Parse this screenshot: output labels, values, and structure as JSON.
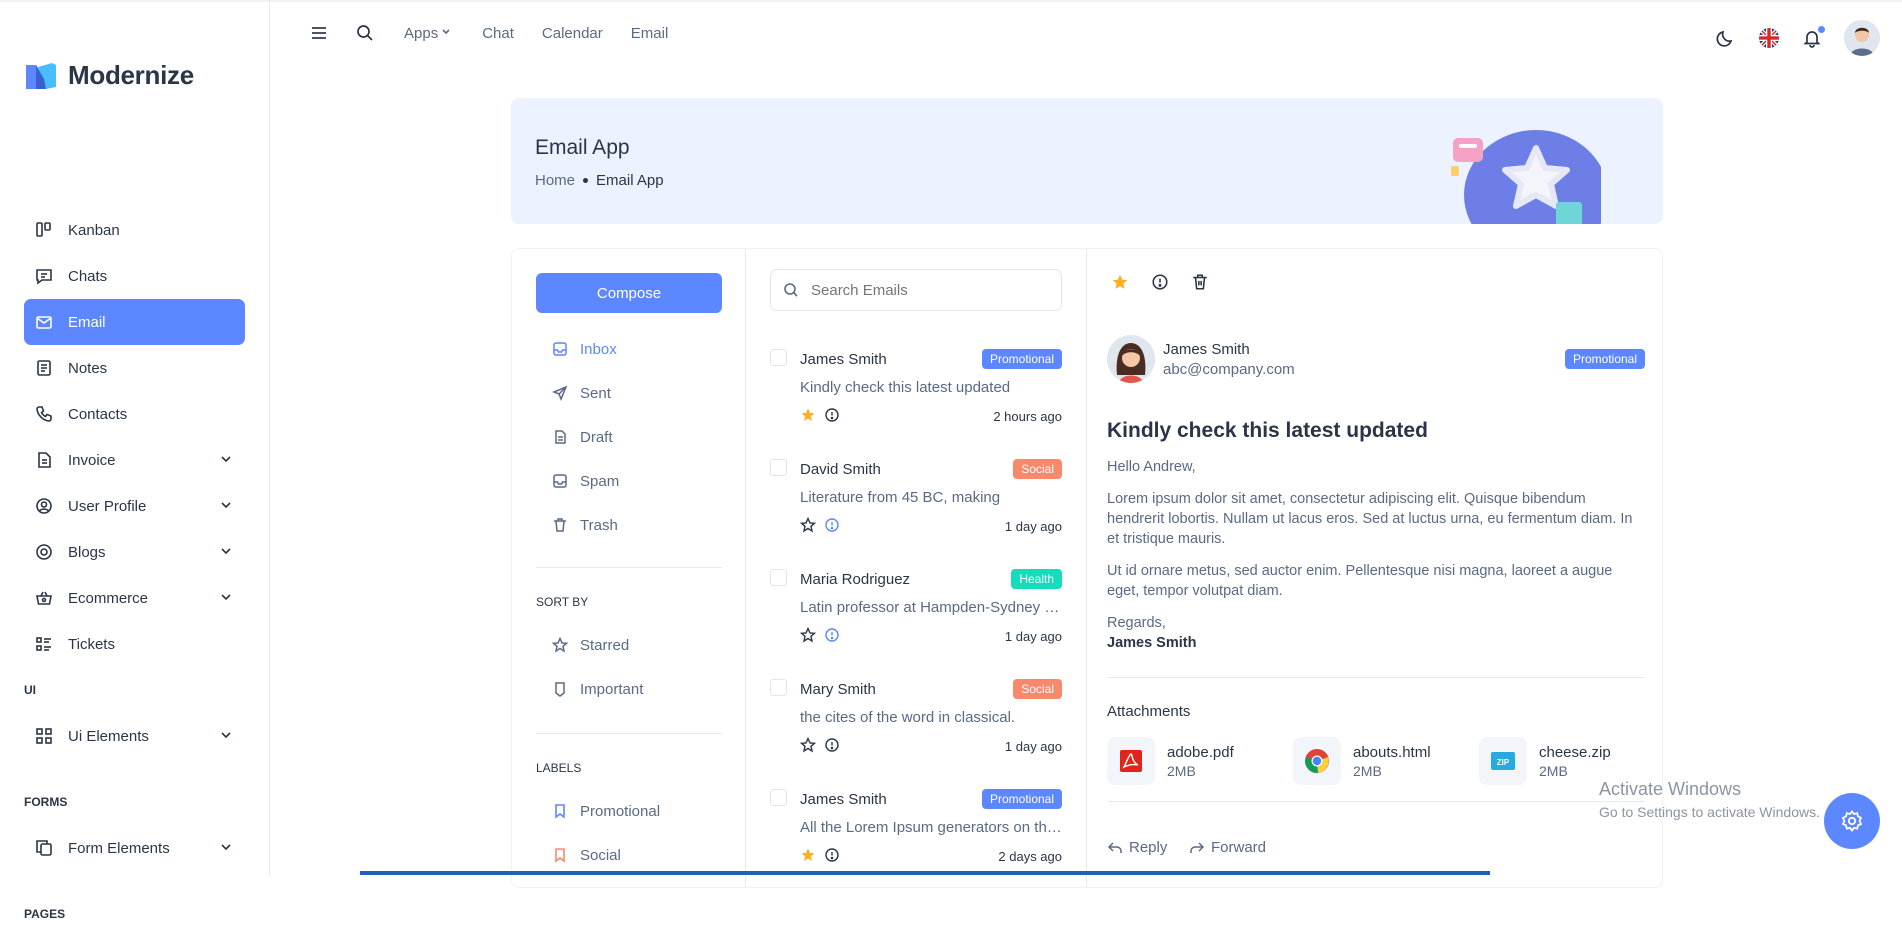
{
  "brand": {
    "name": "Modernize"
  },
  "sidebar": {
    "items": [
      {
        "label": "Kanban",
        "icon": "kanban-icon"
      },
      {
        "label": "Chats",
        "icon": "chat-icon"
      },
      {
        "label": "Email",
        "icon": "mail-icon",
        "active": true
      },
      {
        "label": "Notes",
        "icon": "notes-icon"
      },
      {
        "label": "Contacts",
        "icon": "phone-icon"
      },
      {
        "label": "Invoice",
        "icon": "invoice-icon"
      },
      {
        "label": "User Profile",
        "icon": "user-circle-icon"
      },
      {
        "label": "Blogs",
        "icon": "blog-icon"
      },
      {
        "label": "Ecommerce",
        "icon": "basket-icon"
      },
      {
        "label": "Tickets",
        "icon": "ticket-list-icon"
      }
    ],
    "section_ui": "UI",
    "ui_elements": "Ui Elements",
    "section_forms": "FORMS",
    "form_elements": "Form Elements",
    "section_pages": "PAGES"
  },
  "header": {
    "apps": "Apps",
    "chat": "Chat",
    "calendar": "Calendar",
    "email": "Email"
  },
  "banner": {
    "title": "Email App",
    "crumb_home": "Home",
    "crumb_current": "Email App"
  },
  "folders": {
    "compose": "Compose",
    "inbox": "Inbox",
    "sent": "Sent",
    "draft": "Draft",
    "spam": "Spam",
    "trash": "Trash",
    "sort_by": "SORT BY",
    "starred": "Starred",
    "important": "Important",
    "labels": "LABELS",
    "promotional": "Promotional",
    "social": "Social"
  },
  "search": {
    "placeholder": "Search Emails"
  },
  "mails": [
    {
      "name": "James Smith",
      "badge": "Promotional",
      "subject": "Kindly check this latest updated",
      "time": "2 hours ago",
      "starred": true
    },
    {
      "name": "David Smith",
      "badge": "Social",
      "subject": "Literature from 45 BC, making",
      "time": "1 day ago",
      "starred": false
    },
    {
      "name": "Maria Rodriguez",
      "badge": "Health",
      "subject": "Latin professor at Hampden-Sydney College in Virginia",
      "time": "1 day ago",
      "starred": false
    },
    {
      "name": "Mary Smith",
      "badge": "Social",
      "subject": "the cites of the word in classical.",
      "time": "1 day ago",
      "starred": false
    },
    {
      "name": "James Smith",
      "badge": "Promotional",
      "subject": "All the Lorem Ipsum generators on the Internet",
      "time": "2 days ago",
      "starred": true
    }
  ],
  "colors": {
    "primary": "#5d87ff",
    "promotional": "#5d87ff",
    "social": "#fa896b",
    "health": "#13deb9",
    "star": "#ffae1f"
  },
  "detail": {
    "sender_name": "James Smith",
    "sender_email": "abc@company.com",
    "badge": "Promotional",
    "subject": "Kindly check this latest updated",
    "greeting": "Hello Andrew,",
    "para1": "Lorem ipsum dolor sit amet, consectetur adipiscing elit. Quisque bibendum hendrerit lobortis. Nullam ut lacus eros. Sed at luctus urna, eu fermentum diam. In et tristique mauris.",
    "para2": "Ut id ornare metus, sed auctor enim. Pellentesque nisi magna, laoreet a augue eget, tempor volutpat diam.",
    "regards": "Regards,",
    "signer": "James Smith",
    "attachments_title": "Attachments",
    "attachments": [
      {
        "name": "adobe.pdf",
        "size": "2MB",
        "icon": "pdf-icon"
      },
      {
        "name": "abouts.html",
        "size": "2MB",
        "icon": "chrome-icon"
      },
      {
        "name": "cheese.zip",
        "size": "2MB",
        "icon": "zip-icon"
      }
    ],
    "reply": "Reply",
    "forward": "Forward"
  },
  "watermark": {
    "line1": "Activate Windows",
    "line2": "Go to Settings to activate Windows."
  }
}
